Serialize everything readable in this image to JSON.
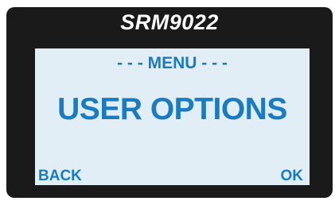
{
  "device": {
    "model": "SRM9022"
  },
  "lcd": {
    "header": "- - - MENU - - -",
    "title": "USER OPTIONS",
    "softkeys": {
      "left": "BACK",
      "right": "OK"
    }
  },
  "colors": {
    "bezel": "#1a1a1a",
    "lcd_background": "#e1eef5",
    "lcd_text": "#1a7bc1",
    "model_text": "#ffffff"
  }
}
